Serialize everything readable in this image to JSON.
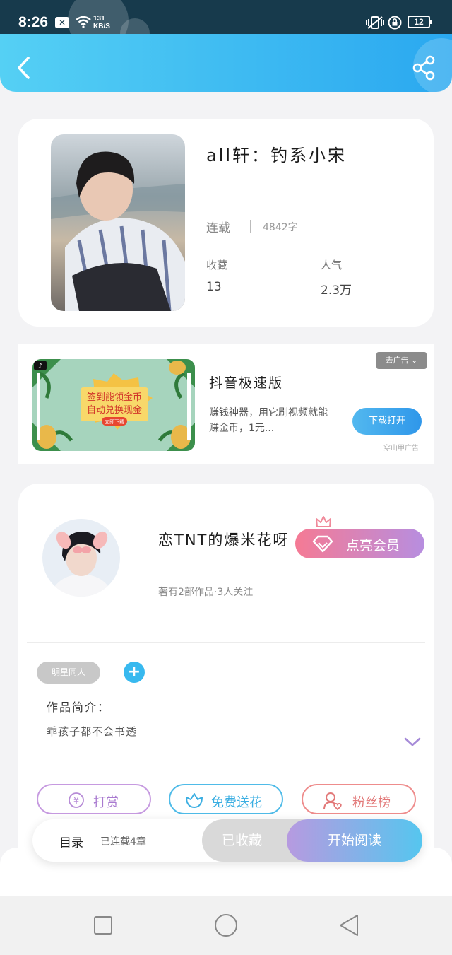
{
  "status_bar": {
    "time": "8:26",
    "net_speed_value": "131",
    "net_speed_unit": "KB/S",
    "battery": "12",
    "icons": [
      "close-box-icon",
      "wifi-icon",
      "vibrate-icon",
      "rotation-lock-icon",
      "battery-icon"
    ]
  },
  "header": {
    "back_icon": "chevron-left-icon",
    "share_icon": "share-icon",
    "accent": "#2aa8f0"
  },
  "book": {
    "title": "all轩：钓系小宋",
    "status": "连载",
    "word_count": "4842字",
    "favorites_label": "收藏",
    "favorites_value": "13",
    "popularity_label": "人气",
    "popularity_value": "2.3万"
  },
  "ad": {
    "title": "抖音极速版",
    "description": "赚钱神器，用它刷视频就能赚金币，1元...",
    "close_label": "去广告",
    "download_label": "下载打开",
    "source": "穿山甲广告",
    "banner_line1": "签到能领金币",
    "banner_line2": "自动兑换现金",
    "banner_cta": "立即下载"
  },
  "author": {
    "name": "恋TNT的爆米花呀",
    "meta": "著有2部作品·3人关注",
    "vip_label": "点亮会员",
    "tag": "明星同人",
    "intro_heading": "作品简介：",
    "intro_text": "乖孩子都不会书透"
  },
  "actions": {
    "reward": "打赏",
    "reward_symbol": "¥",
    "flower": "免费送花",
    "fans": "粉丝榜"
  },
  "bottom": {
    "toc_label": "目录",
    "toc_status": "已连载4章",
    "favorited": "已收藏",
    "read": "开始阅读"
  },
  "nav": [
    "square-icon",
    "circle-icon",
    "triangle-back-icon"
  ]
}
